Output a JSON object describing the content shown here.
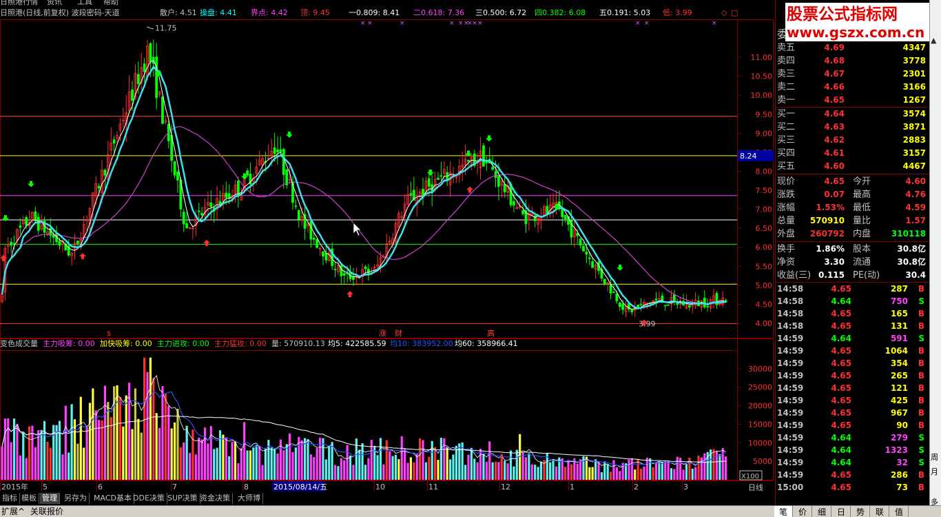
{
  "top_menu": [
    "日照港行情",
    "资讯",
    "工具",
    "帮助"
  ],
  "header": {
    "stock_name": "日照港(日线,前复权) 波段密码-天道",
    "indicators": [
      {
        "label": "散户:",
        "value": "4.51",
        "color": "#c0c0c0"
      },
      {
        "label": "操盘:",
        "value": "4.41",
        "color": "#00ffff"
      },
      {
        "label": "界点:",
        "value": "4.42",
        "color": "#ff40ff"
      },
      {
        "label": "顶:",
        "value": "9.45",
        "color": "#ff3030"
      },
      {
        "label": "一0.809:",
        "value": "8.41",
        "color": "#ffffff"
      },
      {
        "label": "二0.618:",
        "value": "7.36",
        "color": "#ff40ff"
      },
      {
        "label": "三0.500:",
        "value": "6.72",
        "color": "#ffffff"
      },
      {
        "label": "四0.382:",
        "value": "6.08",
        "color": "#00ff00"
      },
      {
        "label": "五0.191:",
        "value": "5.03",
        "color": "#ffffff"
      },
      {
        "label": "低:",
        "value": "3.99",
        "color": "#ff3030"
      }
    ]
  },
  "price_axis": [
    "11.00",
    "10.50",
    "10.00",
    "9.50",
    "9.00",
    "8.50",
    "8.00",
    "7.50",
    "7.00",
    "6.50",
    "6.00",
    "5.50",
    "5.00",
    "4.50",
    "4.00"
  ],
  "price_current_tag": "8.24",
  "annotations": {
    "high": "11.75",
    "low": "3.99"
  },
  "signal_labels": [
    {
      "text": "涨",
      "color": "#ff4040"
    },
    {
      "text": "财",
      "color": "#ff4040"
    },
    {
      "text": "高",
      "color": "#ff4040"
    }
  ],
  "volume_header": [
    {
      "text": "变色成交量",
      "color": "#c0c0c0"
    },
    {
      "text": "主力吸筹: 0.00",
      "color": "#ff40ff"
    },
    {
      "text": "加快吸筹: 0.00",
      "color": "#ffff00"
    },
    {
      "text": "主力进攻: 0.00",
      "color": "#00ff00"
    },
    {
      "text": "主力猛攻: 0.00",
      "color": "#ff3030"
    },
    {
      "text": "量: 570910.13",
      "color": "#c0c0c0"
    },
    {
      "text": "均5: 422585.59",
      "color": "#ffffff"
    },
    {
      "text": "均10: 383952.00",
      "color": "#3050ff"
    },
    {
      "text": "均60: 358966.41",
      "color": "#ffffff"
    }
  ],
  "volume_axis": [
    "30000",
    "25000",
    "20000",
    "15000",
    "10000",
    "5000"
  ],
  "volume_unit": "X100",
  "date_axis": [
    "2015年",
    "5",
    "6",
    "7",
    "8",
    "2015/08/14/五",
    "10",
    "11",
    "12",
    "1",
    "2",
    "3"
  ],
  "period_label": "日线",
  "bottom_tabs": [
    "指标",
    "模板",
    "管理",
    "另存为",
    "MACD基本",
    "DDE决策",
    "SUP决策",
    "资金决策",
    "大师博"
  ],
  "bottom_bar": {
    "left": [
      "扩展^",
      "关联报价"
    ],
    "right_tabs": [
      "笔",
      "价",
      "细",
      "日",
      "势",
      "联",
      "值"
    ]
  },
  "banner": {
    "line1": "股票公式指标网",
    "line2": "www.gszx.com.cn"
  },
  "order_book_title": "委",
  "sell_orders": [
    {
      "label": "卖五",
      "price": "4.69",
      "volume": "4347"
    },
    {
      "label": "卖四",
      "price": "4.68",
      "volume": "3778"
    },
    {
      "label": "卖三",
      "price": "4.67",
      "volume": "2301"
    },
    {
      "label": "卖二",
      "price": "4.66",
      "volume": "3166"
    },
    {
      "label": "卖一",
      "price": "4.65",
      "volume": "1267"
    }
  ],
  "buy_orders": [
    {
      "label": "买一",
      "price": "4.64",
      "volume": "3574"
    },
    {
      "label": "买二",
      "price": "4.63",
      "volume": "3871"
    },
    {
      "label": "买三",
      "price": "4.62",
      "volume": "2883"
    },
    {
      "label": "买四",
      "price": "4.61",
      "volume": "3157"
    },
    {
      "label": "买五",
      "price": "4.60",
      "volume": "4467"
    }
  ],
  "quote_stats": [
    {
      "l1": "现价",
      "v1": "4.65",
      "c1": "#ff3030",
      "l2": "今开",
      "v2": "4.60",
      "c2": "#ff3030"
    },
    {
      "l1": "涨跌",
      "v1": "0.07",
      "c1": "#ff3030",
      "l2": "最高",
      "v2": "4.76",
      "c2": "#ff3030"
    },
    {
      "l1": "涨幅",
      "v1": "1.53%",
      "c1": "#ff3030",
      "l2": "最低",
      "v2": "4.59",
      "c2": "#ff3030"
    },
    {
      "l1": "总量",
      "v1": "570910",
      "c1": "#ffff00",
      "l2": "量比",
      "v2": "1.57",
      "c2": "#ff3030"
    },
    {
      "l1": "外盘",
      "v1": "260792",
      "c1": "#ff3030",
      "l2": "内盘",
      "v2": "310118",
      "c2": "#00ff00"
    },
    {
      "l1": "换手",
      "v1": "1.86%",
      "c1": "#ffffff",
      "l2": "股本",
      "v2": "30.8亿",
      "c2": "#ffffff"
    },
    {
      "l1": "净资",
      "v1": "3.30",
      "c1": "#ffffff",
      "l2": "流通",
      "v2": "30.8亿",
      "c2": "#ffffff"
    },
    {
      "l1": "收益(三)",
      "v1": "0.115",
      "c1": "#ffffff",
      "l2": "PE(动)",
      "v2": "30.4",
      "c2": "#ffffff"
    }
  ],
  "trades": [
    {
      "time": "14:58",
      "price": "4.65",
      "vol": "287",
      "side": "B"
    },
    {
      "time": "14:58",
      "price": "4.64",
      "vol": "750",
      "side": "S"
    },
    {
      "time": "14:58",
      "price": "4.65",
      "vol": "165",
      "side": "B"
    },
    {
      "time": "14:58",
      "price": "4.65",
      "vol": "131",
      "side": "B"
    },
    {
      "time": "14:59",
      "price": "4.64",
      "vol": "591",
      "side": "S"
    },
    {
      "time": "14:59",
      "price": "4.65",
      "vol": "1064",
      "side": "B"
    },
    {
      "time": "14:59",
      "price": "4.65",
      "vol": "354",
      "side": "B"
    },
    {
      "time": "14:59",
      "price": "4.65",
      "vol": "265",
      "side": "B"
    },
    {
      "time": "14:59",
      "price": "4.65",
      "vol": "121",
      "side": "B"
    },
    {
      "time": "14:59",
      "price": "4.65",
      "vol": "425",
      "side": "B"
    },
    {
      "time": "14:59",
      "price": "4.65",
      "vol": "967",
      "side": "B"
    },
    {
      "time": "14:59",
      "price": "4.65",
      "vol": "90",
      "side": "B"
    },
    {
      "time": "14:59",
      "price": "4.64",
      "vol": "279",
      "side": "S"
    },
    {
      "time": "14:59",
      "price": "4.64",
      "vol": "1323",
      "side": "S"
    },
    {
      "time": "14:59",
      "price": "4.64",
      "vol": "32",
      "side": "S"
    },
    {
      "time": "14:59",
      "price": "4.65",
      "vol": "286",
      "side": "B"
    },
    {
      "time": "15:00",
      "price": "4.65",
      "vol": "73",
      "side": "B"
    }
  ],
  "scrollbar_labels": [
    "周",
    "月",
    "多"
  ],
  "colors": {
    "up": "#ff3030",
    "down": "#00ff00",
    "grid": "#800000",
    "accent": "#00ffff",
    "yellow": "#ffff00",
    "magenta": "#ff40ff"
  },
  "chart_data": [
    {
      "type": "candlestick",
      "title": "日照港(日线,前复权) 波段密码-天道",
      "ylim": [
        3.8,
        12.0
      ],
      "x": [
        "2015-04",
        "2015-05",
        "2015-06",
        "2015-07",
        "2015-08",
        "2015-09",
        "2015-10",
        "2015-11",
        "2015-12",
        "2016-01",
        "2016-02",
        "2016-03"
      ],
      "series": [
        {
          "name": "收盘",
          "values": [
            5.9,
            6.5,
            9.8,
            7.0,
            7.9,
            5.3,
            7.5,
            8.1,
            7.0,
            5.2,
            4.5,
            4.65
          ]
        }
      ],
      "horizontal_levels": [
        9.45,
        8.41,
        7.36,
        6.72,
        6.08,
        5.03,
        3.99
      ]
    },
    {
      "type": "bar",
      "title": "变色成交量",
      "ylim": [
        0,
        35000
      ],
      "x": [
        "2015-04",
        "2015-05",
        "2015-06",
        "2015-07",
        "2015-08",
        "2015-09",
        "2015-10",
        "2015-11",
        "2015-12",
        "2016-01",
        "2016-02",
        "2016-03"
      ],
      "series": [
        {
          "name": "量",
          "values": [
            14000,
            11000,
            22000,
            18000,
            8000,
            9000,
            8500,
            8000,
            6500,
            5000,
            4500,
            5700
          ]
        }
      ]
    }
  ]
}
